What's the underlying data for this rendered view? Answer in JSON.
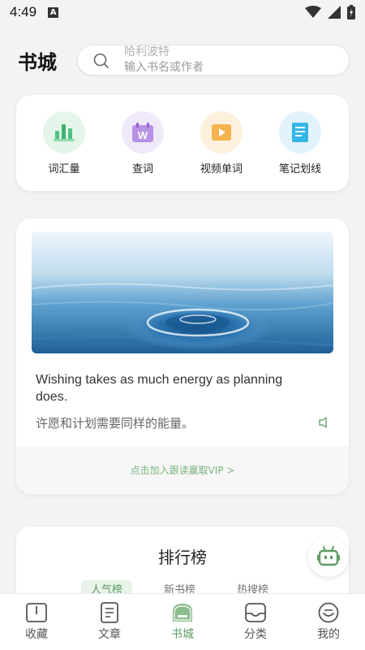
{
  "status_bar": {
    "time": "4:49",
    "a_badge": "A"
  },
  "header": {
    "title": "书城",
    "search_hint_top": "哈利波特",
    "search_placeholder": "输入书名或作者"
  },
  "tools": [
    {
      "label": "词汇量",
      "icon": "bar-chart-icon",
      "bg": "#e4f5ea"
    },
    {
      "label": "查词",
      "icon": "calendar-w-icon",
      "bg": "#efe9f9"
    },
    {
      "label": "视频单词",
      "icon": "video-play-icon",
      "bg": "#fdf1de"
    },
    {
      "label": "笔记划线",
      "icon": "notebook-icon",
      "bg": "#e2f3fb"
    }
  ],
  "quote": {
    "english": "Wishing takes as much energy as planning does.",
    "chinese": "许愿和计划需要同样的能量。",
    "vip_link": "点击加入跟读赢取VIP >"
  },
  "ranking": {
    "title": "排行榜",
    "tabs": [
      "人气榜",
      "新书榜",
      "热搜榜"
    ]
  },
  "tabbar": [
    {
      "label": "收藏",
      "icon": "book-open-icon",
      "active": false
    },
    {
      "label": "文章",
      "icon": "document-icon",
      "active": false
    },
    {
      "label": "书城",
      "icon": "store-icon",
      "active": true
    },
    {
      "label": "分类",
      "icon": "inbox-icon",
      "active": false
    },
    {
      "label": "我的",
      "icon": "smile-icon",
      "active": false
    }
  ],
  "colors": {
    "accent": "#5f9b63",
    "vip_text": "#79b27f"
  }
}
